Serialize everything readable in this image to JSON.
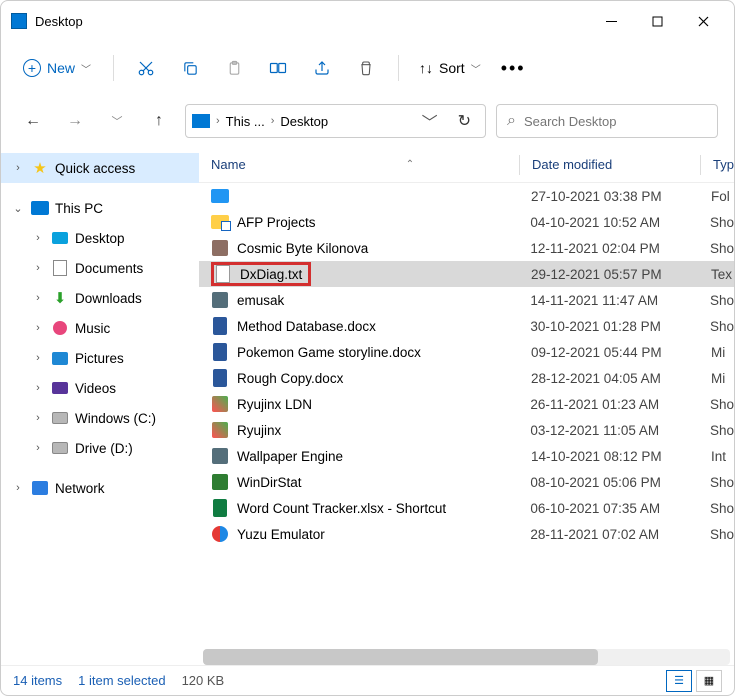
{
  "window": {
    "title": "Desktop"
  },
  "toolbar": {
    "new_label": "New",
    "sort_label": "Sort"
  },
  "breadcrumb": {
    "seg1": "This ...",
    "seg2": "Desktop"
  },
  "search": {
    "placeholder": "Search Desktop"
  },
  "sidebar": {
    "quick_access": "Quick access",
    "this_pc": "This PC",
    "desktop": "Desktop",
    "documents": "Documents",
    "downloads": "Downloads",
    "music": "Music",
    "pictures": "Pictures",
    "videos": "Videos",
    "drive_c": "Windows (C:)",
    "drive_d": "Drive (D:)",
    "network": "Network"
  },
  "columns": {
    "name": "Name",
    "date": "Date modified",
    "type": "Typ"
  },
  "files": [
    {
      "name": "",
      "date": "27-10-2021 03:38 PM",
      "type": "Fol",
      "ic": "fic-folder-blue"
    },
    {
      "name": "AFP Projects",
      "date": "04-10-2021 10:52 AM",
      "type": "Sho",
      "ic": "fic-folder-yel"
    },
    {
      "name": "Cosmic Byte Kilonova",
      "date": "12-11-2021 02:04 PM",
      "type": "Sho",
      "ic": "fic-short"
    },
    {
      "name": "DxDiag.txt",
      "date": "29-12-2021 05:57 PM",
      "type": "Tex",
      "ic": "fic-txt",
      "selected": true,
      "highlight": true
    },
    {
      "name": "emusak",
      "date": "14-11-2021 11:47 AM",
      "type": "Sho",
      "ic": "fic-short2"
    },
    {
      "name": "Method Database.docx",
      "date": "30-10-2021 01:28 PM",
      "type": "Sho",
      "ic": "fic-docx"
    },
    {
      "name": "Pokemon Game storyline.docx",
      "date": "09-12-2021 05:44 PM",
      "type": "Mi",
      "ic": "fic-docx"
    },
    {
      "name": "Rough Copy.docx",
      "date": "28-12-2021 04:05 AM",
      "type": "Mi",
      "ic": "fic-docx"
    },
    {
      "name": "Ryujinx LDN",
      "date": "26-11-2021 01:23 AM",
      "type": "Sho",
      "ic": "fic-app"
    },
    {
      "name": "Ryujinx",
      "date": "03-12-2021 11:05 AM",
      "type": "Sho",
      "ic": "fic-app"
    },
    {
      "name": "Wallpaper Engine",
      "date": "14-10-2021 08:12 PM",
      "type": "Int",
      "ic": "fic-short2"
    },
    {
      "name": "WinDirStat",
      "date": "08-10-2021 05:06 PM",
      "type": "Sho",
      "ic": "fic-wds"
    },
    {
      "name": "Word Count Tracker.xlsx - Shortcut",
      "date": "06-10-2021 07:35 AM",
      "type": "Sho",
      "ic": "fic-xlsx"
    },
    {
      "name": "Yuzu Emulator",
      "date": "28-11-2021 07:02 AM",
      "type": "Sho",
      "ic": "fic-yuzu"
    }
  ],
  "status": {
    "count": "14 items",
    "selected": "1 item selected",
    "size": "120 KB"
  }
}
